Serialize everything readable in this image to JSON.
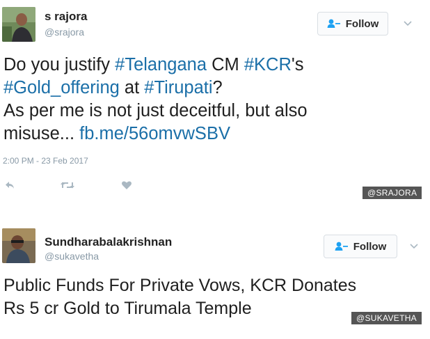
{
  "tweets": [
    {
      "display_name": "s rajora",
      "handle": "@srajora",
      "follow_label": "Follow",
      "text_lines": [
        [
          {
            "t": "Do you justify ",
            "link": false
          },
          {
            "t": "#Telangana",
            "link": true
          },
          {
            "t": " CM ",
            "link": false
          },
          {
            "t": "#KCR",
            "link": true
          },
          {
            "t": "'s",
            "link": false
          }
        ],
        [
          {
            "t": "#Gold_offering",
            "link": true
          },
          {
            "t": " at ",
            "link": false
          },
          {
            "t": "#Tirupati",
            "link": true
          },
          {
            "t": "?",
            "link": false
          }
        ],
        [
          {
            "t": "As per me is not just deceitful, but also",
            "link": false
          }
        ],
        [
          {
            "t": "misuse... ",
            "link": false
          },
          {
            "t": "fb.me/56omvwSBV",
            "link": true
          }
        ]
      ],
      "timestamp": "2:00 PM - 23 Feb 2017",
      "actions": [
        "reply-icon",
        "retweet-icon",
        "like-icon"
      ],
      "watermark": "@SRAJORA"
    },
    {
      "display_name": "Sundharabalakrishnan",
      "handle": "@sukavetha",
      "follow_label": "Follow",
      "text_lines": [
        [
          {
            "t": "Public Funds For Private Vows, KCR Donates",
            "link": false
          }
        ],
        [
          {
            "t": "Rs 5 cr Gold to Tirumala Temple",
            "link": false
          }
        ]
      ],
      "watermark": "@SUKAVETHA"
    }
  ],
  "colors": {
    "link": "#1b6fa8",
    "muted": "#8899a6",
    "follow_icon": "#1da1f2",
    "watermark_bg": "#555555"
  }
}
